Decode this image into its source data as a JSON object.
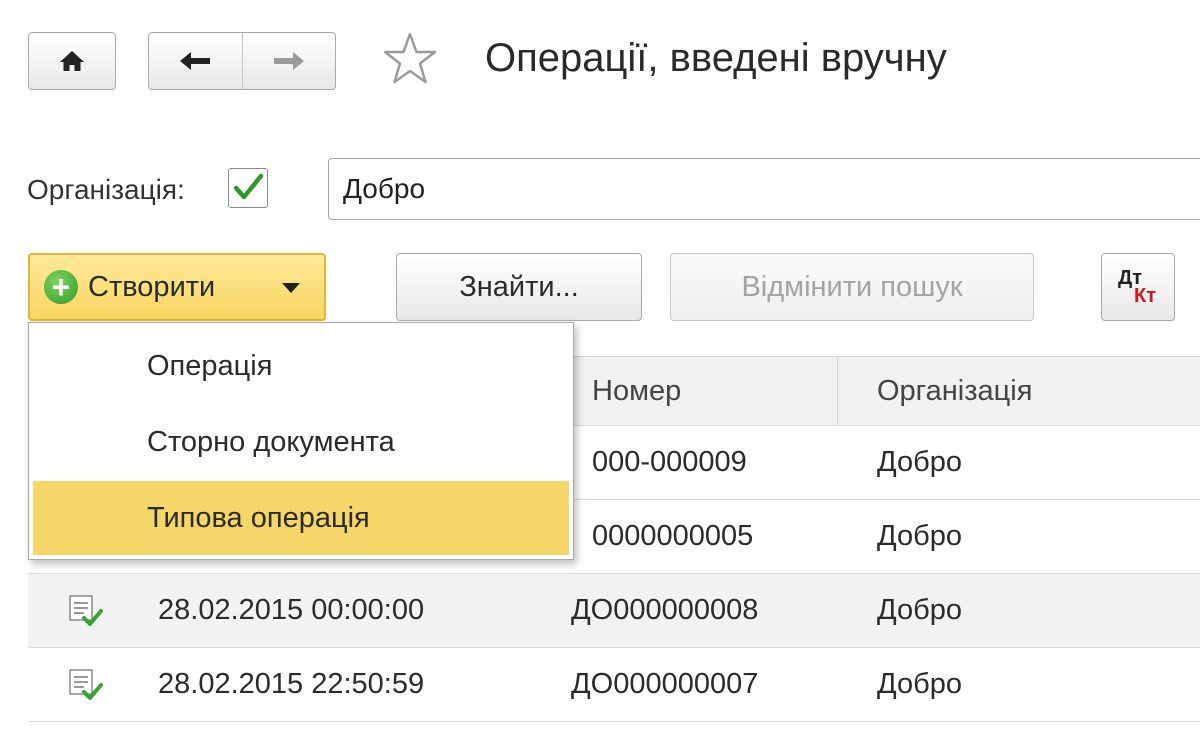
{
  "header": {
    "title": "Операції, введені вручну"
  },
  "filter": {
    "org_label": "Організація:",
    "org_checked": true,
    "org_value": "Добро"
  },
  "toolbar": {
    "create_label": "Створити",
    "find_label": "Знайти...",
    "cancel_search_label": "Відмінити пошук",
    "dt_label": "Дт",
    "kt_label": "Кт"
  },
  "create_menu": {
    "items": [
      {
        "label": "Операція"
      },
      {
        "label": "Сторно документа"
      },
      {
        "label": "Типова операція",
        "highlighted": true
      }
    ]
  },
  "table": {
    "columns": [
      "Номер",
      "Організація"
    ],
    "rows": [
      {
        "date": "",
        "number": "000-000009",
        "org": "Добро"
      },
      {
        "date": "",
        "number": "0000000005",
        "org": "Добро"
      },
      {
        "date": "28.02.2015 00:00:00",
        "number": "ДО000000008",
        "org": "Добро",
        "selected": true
      },
      {
        "date": "28.02.2015 22:50:59",
        "number": "ДО000000007",
        "org": "Добро"
      }
    ]
  },
  "colors": {
    "accent_yellow": "#f8d660",
    "menu_highlight": "#f5d668",
    "check_green": "#2e9a2c",
    "kt_red": "#d01818"
  },
  "icons": [
    "home-icon",
    "arrow-left-icon",
    "arrow-right-icon",
    "star-icon",
    "checkbox-check-icon",
    "plus-circle-icon",
    "dropdown-caret-icon",
    "document-posted-icon"
  ]
}
